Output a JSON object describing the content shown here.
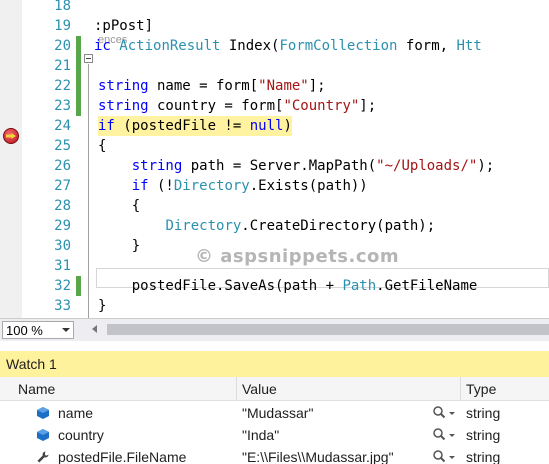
{
  "editor": {
    "lines": [
      {
        "num": "18",
        "segments": []
      },
      {
        "num": "19",
        "tight": true,
        "segments": [
          {
            "t": ":pPost]",
            "c": ""
          }
        ]
      },
      {
        "num": "20",
        "tight": true,
        "changed": true,
        "segments": [
          {
            "t": "ic ",
            "c": "kw"
          },
          {
            "t": "ActionResult",
            "c": "ty"
          },
          {
            "t": " Index(",
            "c": ""
          },
          {
            "t": "FormCollection",
            "c": "ty"
          },
          {
            "t": " form, ",
            "c": ""
          },
          {
            "t": "Htt",
            "c": "ty"
          }
        ]
      },
      {
        "num": "21",
        "changed": true,
        "segments": []
      },
      {
        "num": "22",
        "changed": true,
        "segments": [
          {
            "t": "string",
            "c": "kw"
          },
          {
            "t": " name = form[",
            "c": ""
          },
          {
            "t": "\"Name\"",
            "c": "st"
          },
          {
            "t": "];",
            "c": ""
          }
        ]
      },
      {
        "num": "23",
        "changed": true,
        "segments": [
          {
            "t": "string",
            "c": "kw"
          },
          {
            "t": " country = form[",
            "c": ""
          },
          {
            "t": "\"Country\"",
            "c": "st"
          },
          {
            "t": "];",
            "c": ""
          }
        ]
      },
      {
        "num": "24",
        "highlight": true,
        "segments": [
          {
            "t": "if",
            "c": "kw"
          },
          {
            "t": " (postedFile != ",
            "c": ""
          },
          {
            "t": "null",
            "c": "kw"
          },
          {
            "t": ")",
            "c": ""
          }
        ]
      },
      {
        "num": "25",
        "segments": [
          {
            "t": "{",
            "c": ""
          }
        ]
      },
      {
        "num": "26",
        "segments": [
          {
            "t": "    ",
            "c": ""
          },
          {
            "t": "string",
            "c": "kw"
          },
          {
            "t": " path = Server.MapPath(",
            "c": ""
          },
          {
            "t": "\"~/Uploads/\"",
            "c": "st"
          },
          {
            "t": ");",
            "c": ""
          }
        ]
      },
      {
        "num": "27",
        "segments": [
          {
            "t": "    ",
            "c": ""
          },
          {
            "t": "if",
            "c": "kw"
          },
          {
            "t": " (!",
            "c": ""
          },
          {
            "t": "Directory",
            "c": "ty"
          },
          {
            "t": ".Exists(path))",
            "c": ""
          }
        ]
      },
      {
        "num": "28",
        "segments": [
          {
            "t": "    {",
            "c": ""
          }
        ]
      },
      {
        "num": "29",
        "segments": [
          {
            "t": "        ",
            "c": ""
          },
          {
            "t": "Directory",
            "c": "ty"
          },
          {
            "t": ".CreateDirectory(path);",
            "c": ""
          }
        ]
      },
      {
        "num": "30",
        "segments": [
          {
            "t": "    }",
            "c": ""
          }
        ]
      },
      {
        "num": "31",
        "segments": []
      },
      {
        "num": "32",
        "changed": true,
        "segments": [
          {
            "t": "    postedFile.SaveAs(path + ",
            "c": ""
          },
          {
            "t": "Path",
            "c": "ty"
          },
          {
            "t": ".GetFileName",
            "c": ""
          }
        ]
      },
      {
        "num": "33",
        "segments": [
          {
            "t": "}",
            "c": ""
          }
        ]
      }
    ],
    "references_text": "ences",
    "watermark": "© aspsnippets.com"
  },
  "status": {
    "zoom": "100 %"
  },
  "watch": {
    "title": "Watch 1",
    "columns": {
      "name": "Name",
      "value": "Value",
      "type": "Type"
    },
    "rows": [
      {
        "icon": "field-icon",
        "name": "name",
        "value": "\"Mudassar\"",
        "type": "string"
      },
      {
        "icon": "field-icon",
        "name": "country",
        "value": "\"Inda\"",
        "type": "string"
      },
      {
        "icon": "wrench-property-icon",
        "name": "postedFile.FileName",
        "value": "\"E:\\\\Files\\\\Mudassar.jpg\"",
        "type": "string"
      }
    ]
  },
  "colors": {
    "keyword": "#0000ff",
    "type": "#2b91af",
    "string": "#a31515",
    "line_number": "#2b91af",
    "highlight": "#fff2a0",
    "watch_title_bg": "#fff29d",
    "change_bar": "#57a64a"
  }
}
